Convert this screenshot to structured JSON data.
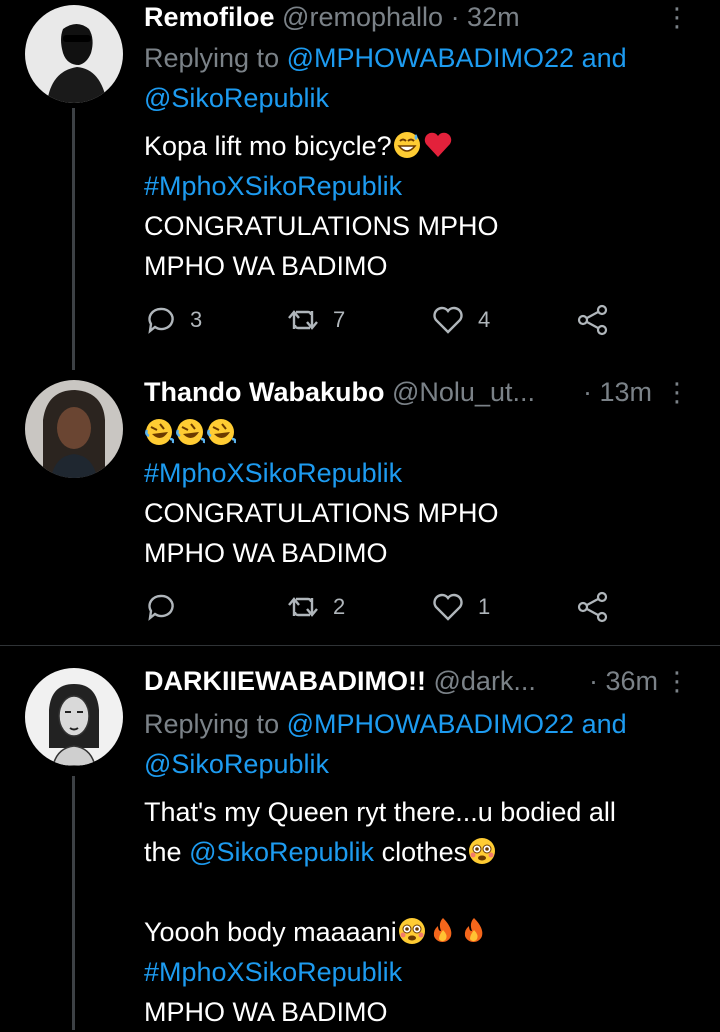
{
  "tweets": [
    {
      "name": "Remofiloe",
      "handle": "@remophallo",
      "time": "· 32m",
      "replying_prefix": "Replying to",
      "replying_user1": "@MPHOWABADIMO22",
      "replying_and": "and",
      "replying_user2": "@SikoRepublik",
      "text1": "Kopa lift mo bicycle?",
      "hashtag": "#MphoXSikoRepublik",
      "text2": "CONGRATULATIONS MPHO",
      "text3": "MPHO WA BADIMO",
      "replies": "3",
      "retweets": "7",
      "likes": "4",
      "emojis": [
        "grinning-sweat-emoji",
        "red-heart-emoji"
      ]
    },
    {
      "name": "Thando Wabakubo",
      "handle": "@Nolu_ut...",
      "time": "· 13m",
      "hashtag": "#MphoXSikoRepublik",
      "text2": "CONGRATULATIONS MPHO",
      "text3": "MPHO WA BADIMO",
      "replies": "",
      "retweets": "2",
      "likes": "1",
      "emojis": [
        "rolling-laughing-emoji",
        "rolling-laughing-emoji",
        "rolling-laughing-emoji"
      ]
    },
    {
      "name": "DARKIIEWABADIMO!!",
      "handle": "@dark...",
      "time": "· 36m",
      "replying_prefix": "Replying to",
      "replying_user1": "@MPHOWABADIMO22",
      "replying_and": "and",
      "replying_user2": "@SikoRepublik",
      "text1": "That's my Queen ryt there...u bodied all",
      "text1b_pre": "the",
      "text1b_mention": "@SikoRepublik",
      "text1b_post": "clothes",
      "text4": "Yoooh body maaaani",
      "hashtag": "#MphoXSikoRepublik",
      "text3": "MPHO WA BADIMO",
      "emojis": [
        "flushed-face-emoji",
        "fire-emoji",
        "fire-emoji"
      ]
    }
  ],
  "colors": {
    "background": "#000000",
    "link": "#1d9bf0",
    "muted": "#7b8288",
    "like": "#b0b6bb"
  }
}
